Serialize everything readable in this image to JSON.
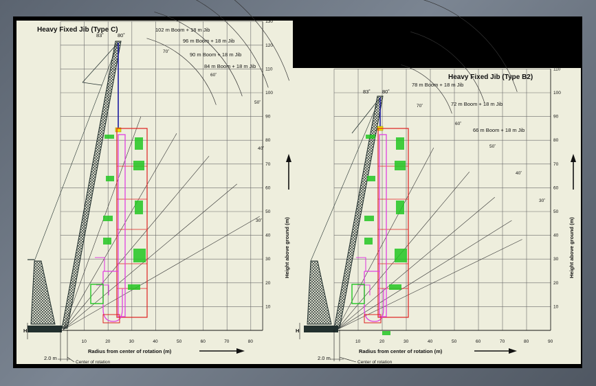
{
  "colors": {
    "panel": "#eeeedd",
    "grid": "#6a6a6a",
    "crane": "#22302e",
    "boom_line": "#1a1aa0",
    "frame_red": "#dd2020",
    "magenta": "#e040e0",
    "green": "#22c622",
    "bg_black": "#000000"
  },
  "left": {
    "title": "Heavy Fixed Jib (Type C)",
    "top_angles": [
      "83˚",
      "80˚"
    ],
    "configs": [
      {
        "label": "102 m Boom + 18 m Jib"
      },
      {
        "label": "96 m Boom + 18 m Jib"
      },
      {
        "label": "90 m Boom + 18 m Jib"
      },
      {
        "label": "84 m Boom + 18 m Jib"
      }
    ],
    "jib_angles": [
      "70˚",
      "60˚",
      "50˚",
      "40˚",
      "30˚"
    ],
    "x_ticks": [
      "10",
      "20",
      "30",
      "40",
      "50",
      "60",
      "70",
      "80"
    ],
    "y_ticks": [
      "10",
      "20",
      "30",
      "40",
      "50",
      "60",
      "70",
      "80",
      "90",
      "100",
      "110",
      "120",
      "130"
    ],
    "y_axis_label": "Height above ground (m)",
    "x_axis_label": "Radius from center of rotation (m)",
    "offset_label": "2.0 m",
    "h_label": "H",
    "center_label": "Center of rotation"
  },
  "right": {
    "title": "Heavy Fixed Jib (Type B2)",
    "top_angles": [
      "83˚",
      "80˚"
    ],
    "configs": [
      {
        "label": "78 m Boom + 18 m Jib"
      },
      {
        "label": "72 m Boom + 18 m Jib"
      },
      {
        "label": "66 m Boom + 18 m Jib"
      }
    ],
    "jib_angles": [
      "70˚",
      "60˚",
      "50˚",
      "40˚",
      "30˚"
    ],
    "x_ticks": [
      "10",
      "20",
      "30",
      "40",
      "50",
      "60",
      "70",
      "80",
      "90"
    ],
    "y_ticks": [
      "10",
      "20",
      "30",
      "40",
      "50",
      "60",
      "70",
      "80",
      "90",
      "100",
      "110"
    ],
    "y_axis_label": "Height above ground (m)",
    "x_axis_label": "Radius from center of rotation (m)",
    "offset_label": "2.0 m",
    "h_label": "H",
    "center_label": "Center of rotation"
  }
}
